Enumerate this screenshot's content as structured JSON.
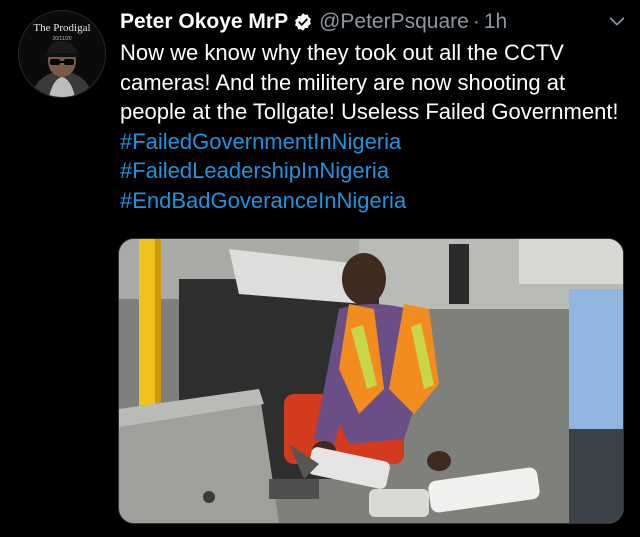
{
  "author": {
    "display_name": "Peter Okoye MrP",
    "handle": "@PeterPsquare",
    "separator": "·",
    "time": "1h",
    "avatar": {
      "label": "The Prodigal",
      "date": "20/11/20"
    }
  },
  "tweet": {
    "text": "Now we know why they took out all the CCTV cameras! And the militery  are now shooting at people at the Tollgate!  Useless Failed Government! ",
    "hashtags": [
      "#FailedGovernmentInNigeria",
      "#FailedLeadershipInNigeria",
      "#EndBadGoveranceInNigeria"
    ]
  },
  "icons": {
    "verified": "verified-badge-icon",
    "more": "chevron-down-icon"
  },
  "colors": {
    "background": "#000000",
    "text": "#ffffff",
    "muted": "#8899a6",
    "link": "#1b95e0",
    "vest_orange": "#f28c1e",
    "vest_stripe": "#c8d64a"
  }
}
